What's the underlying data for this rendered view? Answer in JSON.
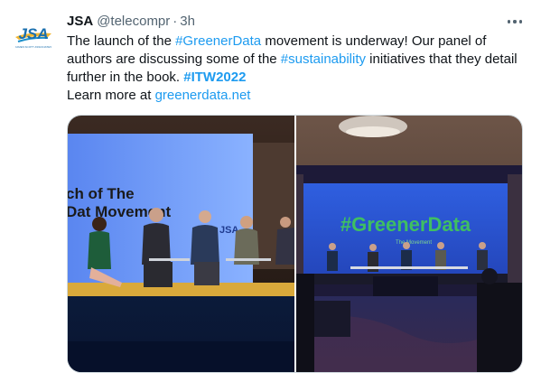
{
  "tweet": {
    "author_name": "JSA",
    "author_handle": "@telecompr",
    "separator": "·",
    "time": "3h",
    "text": {
      "part1": "The launch of the ",
      "hashtag1": "#GreenerData",
      "part2": " movement is underway! Our panel of authors are discussing some of the ",
      "hashtag2": "#sustainability",
      "part3": " initiatives that they detail further in the book. ",
      "hashtag3": "#ITW2022",
      "learn_more": "Learn more at ",
      "link": "greenerdata.net"
    }
  },
  "avatar": {
    "logo_text": "JSA",
    "logo_subtext": "JAMES SCOTT ASSOCIATES"
  },
  "media": {
    "left_photo": {
      "screen_text_line1": "ch of The",
      "screen_text_line2": "Dat Movement",
      "banner_text": "JSA"
    },
    "right_photo": {
      "screen_hashtag": "#GreenerData",
      "screen_subtitle": "The Movement"
    }
  },
  "colors": {
    "link": "#1d9bf0",
    "text": "#0f1419",
    "muted": "#536471",
    "border": "#cfd9de",
    "screen_green": "#3fbf62",
    "stage_blue": "#2f5fe0"
  },
  "icons": {
    "more": "more-horizontal-icon"
  }
}
